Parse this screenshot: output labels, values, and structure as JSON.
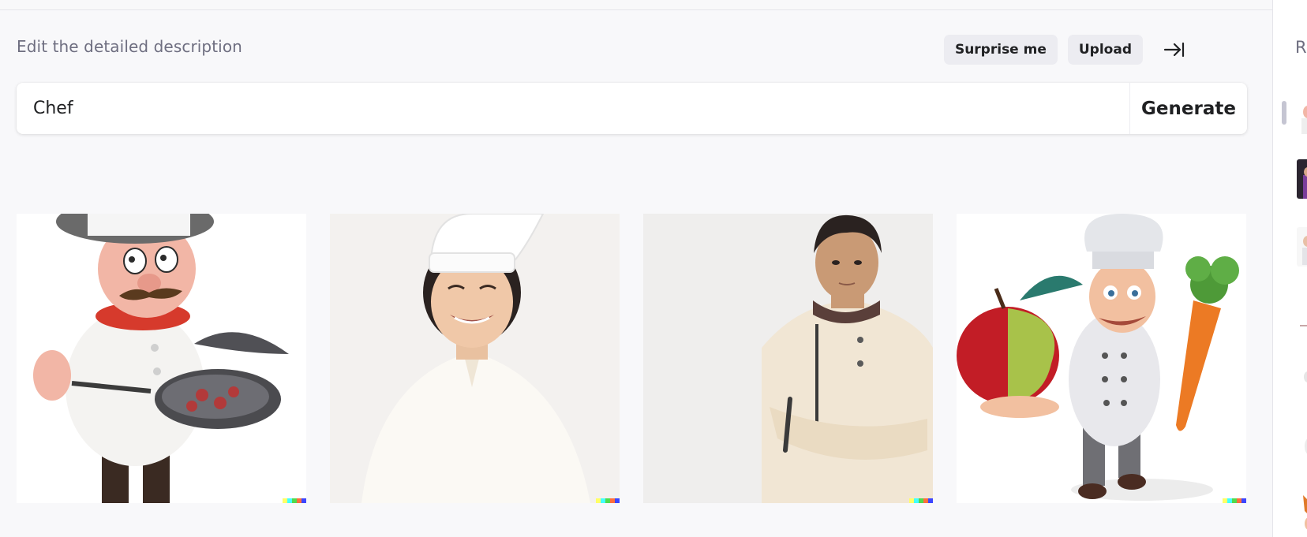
{
  "header": {
    "edit_label": "Edit the detailed description",
    "surprise_label": "Surprise me",
    "upload_label": "Upload",
    "collapse_icon": "collapse-right-icon"
  },
  "prompt": {
    "value": "Chef",
    "generate_label": "Generate"
  },
  "results": [
    {
      "description": "Cartoon mustached chef holding a frying pan"
    },
    {
      "description": "Smiling chef in white toque"
    },
    {
      "description": "Chef in white jacket with arms crossed"
    },
    {
      "description": "Cartoon chef holding an apple and a carrot"
    }
  ],
  "signature_colors": [
    "#ffff66",
    "#42ffff",
    "#51da4c",
    "#ff6e3c",
    "#3c46ff"
  ],
  "history": {
    "heading": "R",
    "thumbnail_count": 9
  }
}
